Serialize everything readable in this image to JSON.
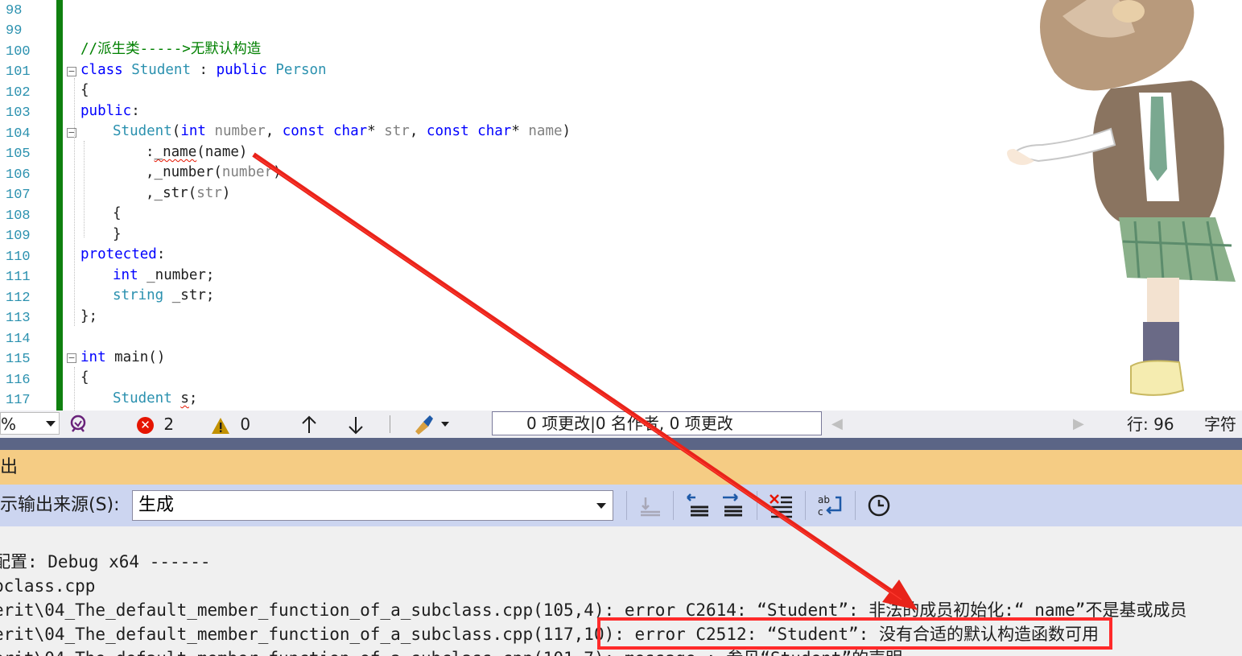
{
  "editor": {
    "line_numbers": [
      "98",
      "99",
      "100",
      "101",
      "102",
      "103",
      "104",
      "105",
      "106",
      "107",
      "108",
      "109",
      "110",
      "111",
      "112",
      "113",
      "114",
      "115",
      "116",
      "117"
    ],
    "code": {
      "l100_comment": "//派生类----->无默认构造",
      "l101_kw": "class",
      "l101_name": "Student",
      "l101_colon": " : ",
      "l101_access": "public",
      "l101_base": "Person",
      "l102": "{",
      "l103_kw": "public",
      "l103_colon": ":",
      "l104_name": "Student",
      "l104_p1": "(",
      "l104_int": "int",
      "l104_number": " number",
      "l104_comma1": ", ",
      "l104_const1": "const",
      "l104_char1": "char",
      "l104_star1": "* ",
      "l104_str": "str",
      "l104_comma2": ", ",
      "l104_const2": "const",
      "l104_char2": "char",
      "l104_star2": "* ",
      "l104_name_param": "name",
      "l104_p2": ")",
      "l105_colon": ":",
      "l105_member": "_name",
      "l105_arg": "(name)",
      "l106_comma": ",",
      "l106_member": "_number",
      "l106_p1": "(",
      "l106_arg": "number",
      "l106_p2": ")",
      "l107_comma": ",",
      "l107_member": "_str",
      "l107_p1": "(",
      "l107_arg": "str",
      "l107_p2": ")",
      "l108": "{",
      "l109": "}",
      "l110_kw": "protected",
      "l110_colon": ":",
      "l111_type": "int",
      "l111_rest": " _number;",
      "l112_type": "string",
      "l112_rest": " _str;",
      "l113": "};",
      "l115_kw": "int",
      "l115_rest": " main()",
      "l116": "{",
      "l117_type": "Student",
      "l117_sp": " ",
      "l117_var": "s",
      "l117_semi": ";"
    }
  },
  "status_strip": {
    "zoom": "%",
    "errors": "2",
    "warnings": "0",
    "changes": "0 项更改|0 名作者, 0 项更改",
    "line": "行: 96",
    "char": "字符"
  },
  "output": {
    "title": "出",
    "source_label": "示输出来源(S):",
    "source_value": "生成",
    "lines": [
      "配置: Debug x64 ------",
      "bclass.cpp",
      "erit\\04_The_default_member_function_of_a_subclass.cpp(105,4): error C2614: “Student”: 非法的成员初始化:“_name”不是基或成员",
      "erit\\04_The_default_member_function_of_a_subclass.cpp(117,10): error C2512: “Student”: 没有合适的默认构造函数可用",
      "erit\\04_The_default_member_function_of_a_subclass.cpp(101,7): message : 参见“Student”的声明"
    ]
  },
  "colors": {
    "keyword": "#0000ff",
    "type": "#2b91af",
    "comment": "#008000",
    "output_title_bg": "#f5cc84",
    "output_toolbar_bg": "#ccd5f0",
    "annotation": "#ff2a2a"
  },
  "icons": [
    "live-share-icon",
    "error-icon",
    "warning-icon",
    "up-arrow-icon",
    "down-arrow-icon",
    "cleanup-brush-icon",
    "goto-build-icon",
    "prev-message-icon",
    "next-message-icon",
    "clear-all-icon",
    "word-wrap-icon",
    "clock-icon"
  ]
}
